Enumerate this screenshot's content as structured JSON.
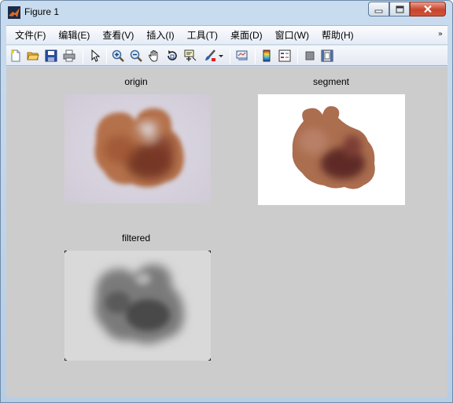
{
  "window": {
    "title": "Figure 1"
  },
  "menu": {
    "items": [
      "文件(F)",
      "编辑(E)",
      "查看(V)",
      "插入(I)",
      "工具(T)",
      "桌面(D)",
      "窗口(W)",
      "帮助(H)"
    ],
    "overflow_icon": "chevron-double-icon"
  },
  "toolbar": {
    "icons": [
      "new-figure-icon",
      "open-file-icon",
      "save-icon",
      "print-icon",
      "select-arrow-icon",
      "zoom-in-icon",
      "zoom-out-icon",
      "pan-hand-icon",
      "rotate-3d-icon",
      "data-cursor-icon",
      "brush-icon",
      "link-plot-icon",
      "colorbar-icon",
      "legend-icon",
      "hide-plot-tools-icon",
      "show-plot-tools-icon"
    ]
  },
  "plots": {
    "origin_title": "origin",
    "segment_title": "segment",
    "filtered_title": "filtered"
  },
  "colors": {
    "figure_background": "#cccccc",
    "lesion_brown": "#a35a34",
    "lesion_dark": "#6a2e22",
    "skin": "#d8d4de"
  }
}
